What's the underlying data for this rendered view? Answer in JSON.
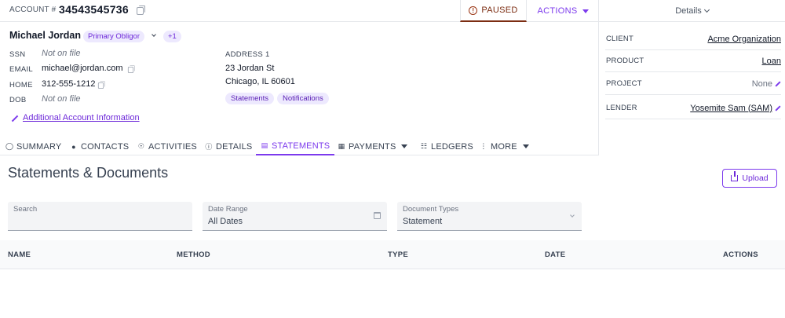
{
  "header": {
    "account_label": "ACCOUNT #",
    "account_number": "34543545736",
    "status": "PAUSED",
    "actions_label": "ACTIONS",
    "details_label": "Details"
  },
  "customer": {
    "name": "Michael Jordan",
    "role_badge": "Primary Obligor",
    "extra_count": "+1",
    "ssn_label": "SSN",
    "ssn_value": "Not on file",
    "email_label": "EMAIL",
    "email_value": "michael@jordan.com",
    "home_label": "HOME",
    "home_value": "312-555-1212",
    "dob_label": "DOB",
    "dob_value": "Not on file",
    "address_label": "ADDRESS 1",
    "address_line1": "23 Jordan St",
    "address_line2": "Chicago, IL 60601",
    "tags": [
      "Statements",
      "Notifications"
    ],
    "additional_info_link": "Additional Account Information"
  },
  "details_panel": {
    "rows": [
      {
        "label": "CLIENT",
        "value": "Acme Organization"
      },
      {
        "label": "PRODUCT",
        "value": "Loan"
      },
      {
        "label": "PROJECT",
        "value": "None"
      },
      {
        "label": "LENDER",
        "value": "Yosemite Sam (SAM)"
      }
    ]
  },
  "tabs": [
    {
      "label": "SUMMARY",
      "icon": "person-icon"
    },
    {
      "label": "CONTACTS",
      "icon": "people-icon"
    },
    {
      "label": "ACTIVITIES",
      "icon": "broadcast-icon"
    },
    {
      "label": "DETAILS",
      "icon": "info-icon"
    },
    {
      "label": "STATEMENTS",
      "icon": "document-icon",
      "active": true
    },
    {
      "label": "PAYMENTS",
      "icon": "payment-icon"
    },
    {
      "label": "LEDGERS",
      "icon": "ledger-icon"
    },
    {
      "label": "MORE",
      "icon": "more-vertical-icon"
    }
  ],
  "main": {
    "title": "Statements & Documents",
    "upload_label": "Upload",
    "filters": {
      "search_label": "Search",
      "date_range_label": "Date Range",
      "date_range_value": "All Dates",
      "doc_types_label": "Document Types",
      "doc_types_value": "Statement"
    },
    "table": {
      "columns": [
        "NAME",
        "METHOD",
        "TYPE",
        "DATE",
        "ACTIONS"
      ]
    }
  },
  "colors": {
    "accent": "#7c3aed",
    "paused": "#7c2d12",
    "badge_bg": "#ede9fe"
  }
}
